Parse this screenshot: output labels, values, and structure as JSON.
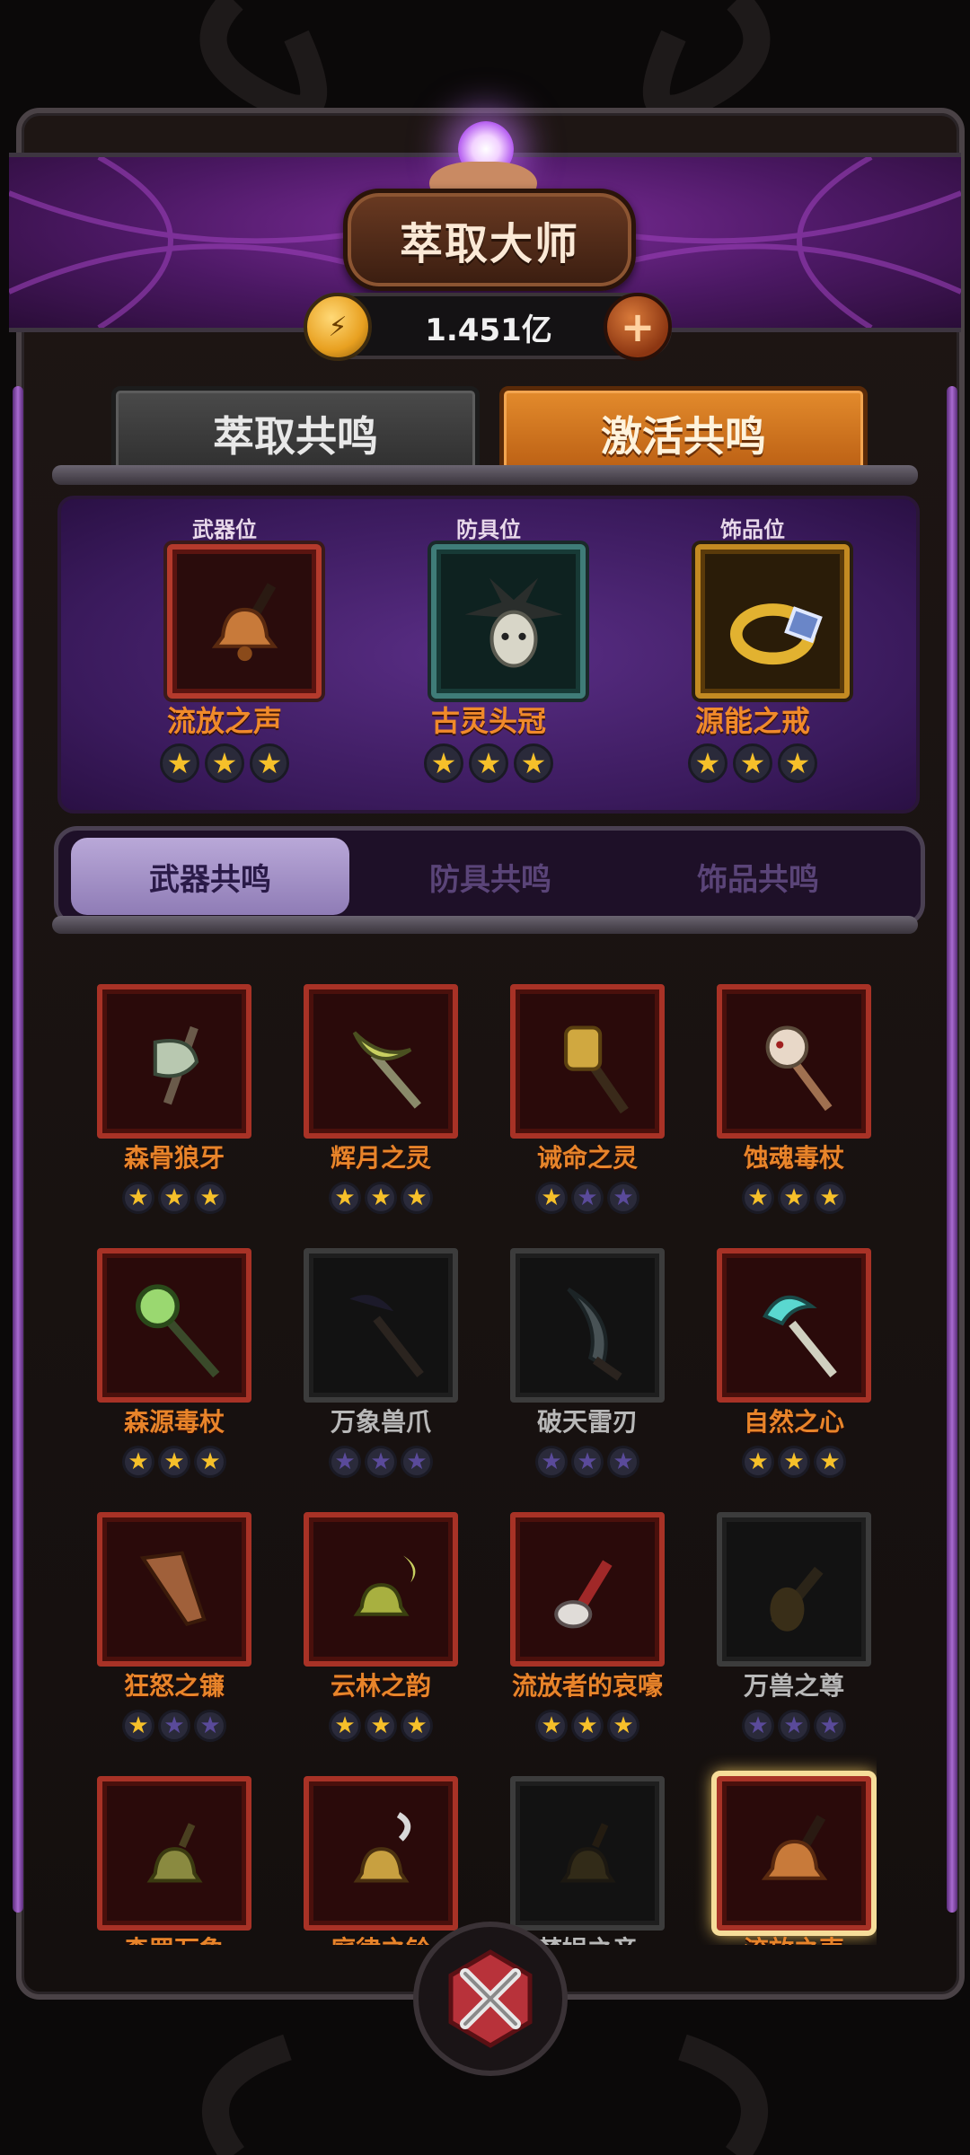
{
  "header": {
    "title": "萃取大师"
  },
  "currency": {
    "amount": "1.451亿",
    "add_label": "+"
  },
  "top_tabs": [
    {
      "label": "萃取共鸣",
      "active": false
    },
    {
      "label": "激活共鸣",
      "active": true
    }
  ],
  "equipped": [
    {
      "slot_label": "武器位",
      "name": "流放之声",
      "stars": 3,
      "rarity": "red",
      "icon": "bell-icon"
    },
    {
      "slot_label": "防具位",
      "name": "古灵头冠",
      "stars": 3,
      "rarity": "teal",
      "icon": "feather-crown-icon"
    },
    {
      "slot_label": "饰品位",
      "name": "源能之戒",
      "stars": 3,
      "rarity": "gold",
      "icon": "ring-icon"
    }
  ],
  "sub_tabs": [
    {
      "label": "武器共鸣",
      "active": true
    },
    {
      "label": "防具共鸣",
      "active": false
    },
    {
      "label": "饰品共鸣",
      "active": false
    }
  ],
  "weapons": [
    {
      "name": "森骨狼牙",
      "stars": 3,
      "unlocked": true,
      "icon": "bone-axe-icon"
    },
    {
      "name": "辉月之灵",
      "stars": 3,
      "unlocked": true,
      "icon": "crescent-staff-icon"
    },
    {
      "name": "诫命之灵",
      "stars": 1,
      "unlocked": true,
      "icon": "golden-mace-icon"
    },
    {
      "name": "蚀魂毒杖",
      "stars": 3,
      "unlocked": true,
      "icon": "skull-staff-icon"
    },
    {
      "name": "森源毒杖",
      "stars": 3,
      "unlocked": true,
      "icon": "orb-staff-icon"
    },
    {
      "name": "万象兽爪",
      "stars": 0,
      "unlocked": false,
      "icon": "claw-staff-icon"
    },
    {
      "name": "破天雷刃",
      "stars": 0,
      "unlocked": false,
      "icon": "blade-icon"
    },
    {
      "name": "自然之心",
      "stars": 3,
      "unlocked": true,
      "icon": "crystal-staff-icon"
    },
    {
      "name": "狂怒之镰",
      "stars": 1,
      "unlocked": true,
      "icon": "scythe-icon"
    },
    {
      "name": "云林之韵",
      "stars": 3,
      "unlocked": true,
      "icon": "moon-bell-icon"
    },
    {
      "name": "流放者的哀嚎",
      "stars": 3,
      "unlocked": true,
      "icon": "bone-club-icon"
    },
    {
      "name": "万兽之尊",
      "stars": 0,
      "unlocked": false,
      "icon": "beast-horn-icon"
    },
    {
      "name": "森罗万象",
      "stars": 0,
      "unlocked": true,
      "icon": "green-bell-icon"
    },
    {
      "name": "庭律之铃",
      "stars": 0,
      "unlocked": true,
      "icon": "hook-bell-icon"
    },
    {
      "name": "梵娲之音",
      "stars": 0,
      "unlocked": false,
      "icon": "dark-bell-icon"
    },
    {
      "name": "流放之声",
      "stars": 0,
      "unlocked": true,
      "selected": true,
      "icon": "bell-icon"
    }
  ],
  "colors": {
    "accent_orange": "#e8842a",
    "star_gold": "#f6c02a",
    "panel_purple": "#4b1863"
  }
}
